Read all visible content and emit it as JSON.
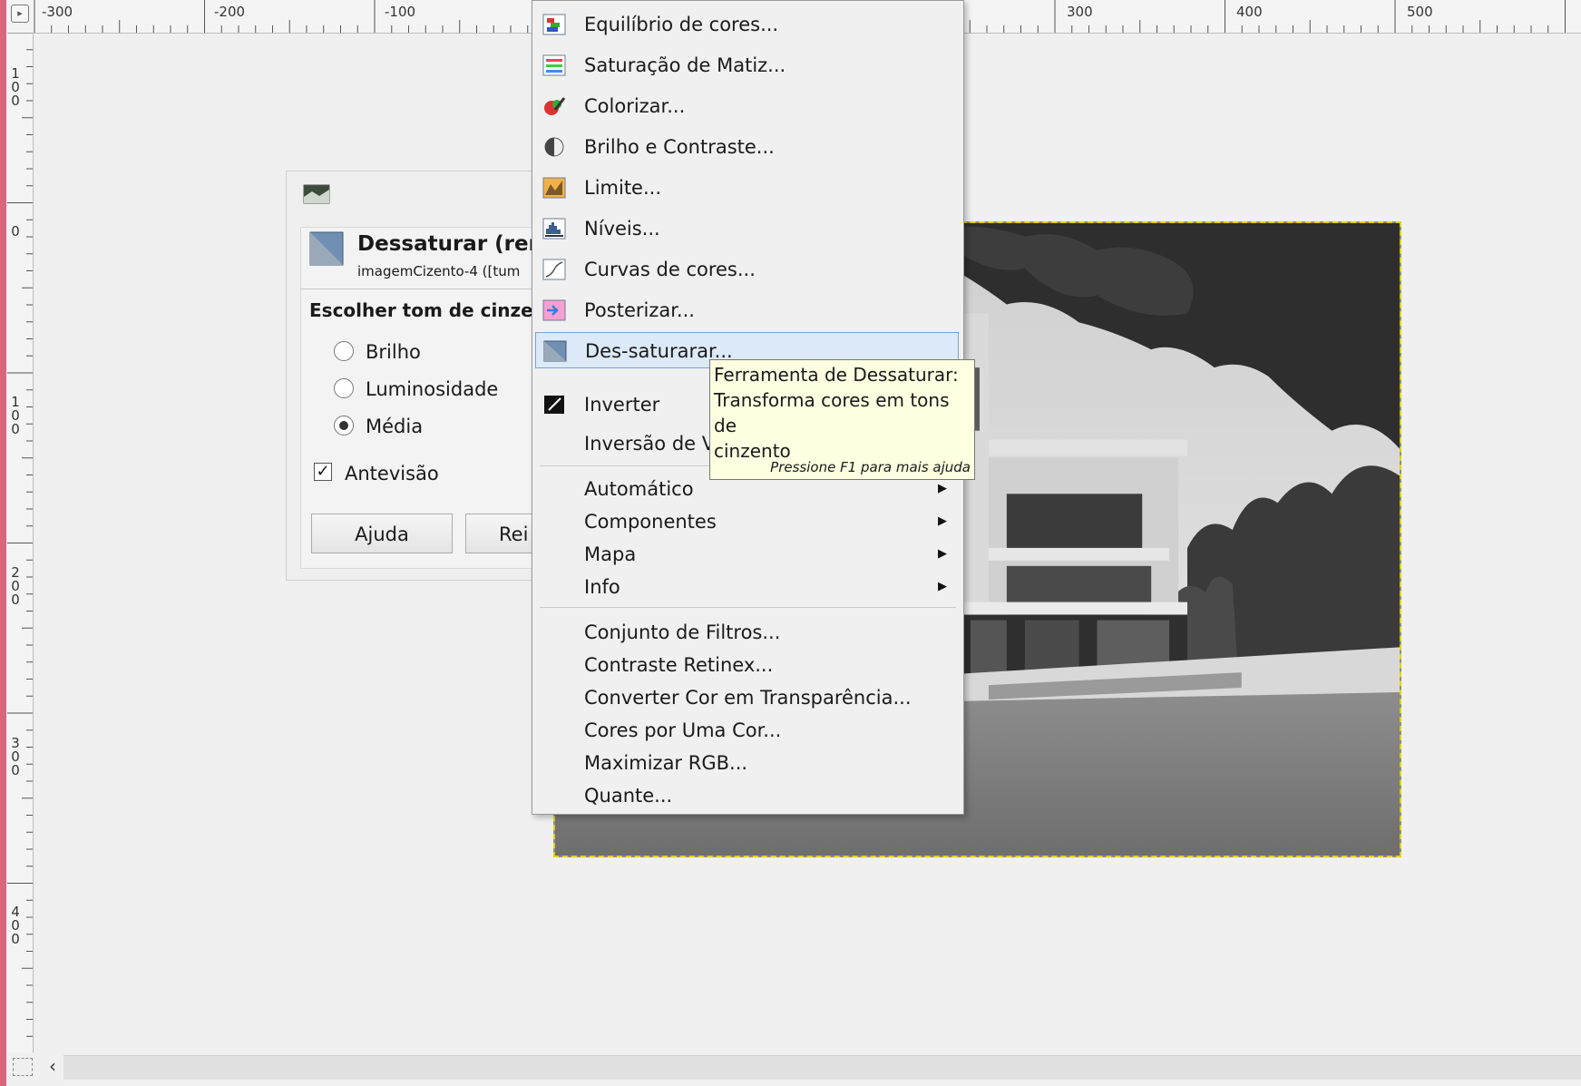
{
  "ruler": {
    "top_labels": [
      "-300",
      "-200",
      "-100",
      "300",
      "400",
      "500"
    ],
    "left_labels": [
      "1\n0\n0",
      "0",
      "1\n0\n0",
      "2\n0\n0",
      "3\n0\n0",
      "4\n0\n0"
    ]
  },
  "dialog": {
    "title": "Dessaturar (rem",
    "subtitle": "imagemCizento-4 ([tum",
    "section_label": "Escolher tom de cinzent",
    "options": [
      {
        "label": "Brilho",
        "selected": false
      },
      {
        "label": "Luminosidade",
        "selected": false
      },
      {
        "label": "Média",
        "selected": true
      }
    ],
    "preview_checked": true,
    "preview_label": "Antevisão",
    "help_button": "Ajuda",
    "reset_button": "Rei"
  },
  "menu": {
    "items": [
      {
        "label": "Equilíbrio de cores...",
        "icon": "color-balance-icon",
        "submenu": false
      },
      {
        "label": "Saturação de Matiz...",
        "icon": "hue-saturation-icon",
        "submenu": false
      },
      {
        "label": "Colorizar...",
        "icon": "colorize-icon",
        "submenu": false
      },
      {
        "label": "Brilho e Contraste...",
        "icon": "brightness-contrast-icon",
        "submenu": false
      },
      {
        "label": "Limite...",
        "icon": "threshold-icon",
        "submenu": false
      },
      {
        "label": "Níveis...",
        "icon": "levels-icon",
        "submenu": false
      },
      {
        "label": "Curvas de cores...",
        "icon": "curves-icon",
        "submenu": false
      },
      {
        "label": "Posterizar...",
        "icon": "posterize-icon",
        "submenu": false
      },
      {
        "label": "Des-saturarar...",
        "icon": "desaturate-icon",
        "submenu": false,
        "selected": true
      },
      {
        "label": "Inverter",
        "icon": "invert-icon",
        "submenu": false
      },
      {
        "label": "Inversão de Va",
        "icon": "",
        "submenu": false
      },
      {
        "label": "Automático",
        "icon": "",
        "submenu": true
      },
      {
        "label": "Componentes",
        "icon": "",
        "submenu": true
      },
      {
        "label": "Mapa",
        "icon": "",
        "submenu": true
      },
      {
        "label": "Info",
        "icon": "",
        "submenu": true
      },
      {
        "label": "Conjunto de Filtros...",
        "icon": "",
        "submenu": false
      },
      {
        "label": "Contraste Retinex...",
        "icon": "",
        "submenu": false
      },
      {
        "label": "Converter Cor em Transparência...",
        "icon": "",
        "submenu": false
      },
      {
        "label": "Cores por Uma Cor...",
        "icon": "",
        "submenu": false
      },
      {
        "label": "Maximizar RGB...",
        "icon": "",
        "submenu": false
      },
      {
        "label": "Quante...",
        "icon": "",
        "submenu": false
      }
    ]
  },
  "tooltip": {
    "text": "Ferramenta de Dessaturar:\nTransforma cores em tons de\ncinzento",
    "hint": "Pressione F1 para mais ajuda"
  },
  "colors": {
    "selection_border": "#e5d200",
    "menu_highlight": "#dce9f8",
    "tooltip_bg": "#ffffe1"
  }
}
